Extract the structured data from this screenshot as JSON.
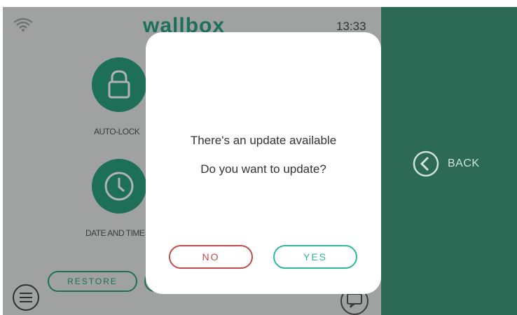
{
  "header": {
    "brand": "wallbox",
    "time": "13:33",
    "wifi_icon": "wifi-icon"
  },
  "settings": {
    "items": [
      {
        "label": "AUTO-LOCK",
        "icon": "lock-icon"
      },
      {
        "label": "DATE AND TIME",
        "icon": "clock-icon"
      }
    ],
    "restore_label": "RESTORE"
  },
  "footer": {
    "menu_icon": "menu-icon",
    "chat_icon": "chat-icon"
  },
  "side": {
    "back_label": "BACK",
    "back_icon": "chevron-left-icon"
  },
  "dialog": {
    "line1": "There's an update available",
    "line2": "Do you want to update?",
    "no_label": "NO",
    "yes_label": "YES"
  },
  "colors": {
    "brand_green": "#2aa37f",
    "panel_green": "#2d6a55",
    "no_red": "#c24a4a",
    "yes_teal": "#2fb79a"
  }
}
